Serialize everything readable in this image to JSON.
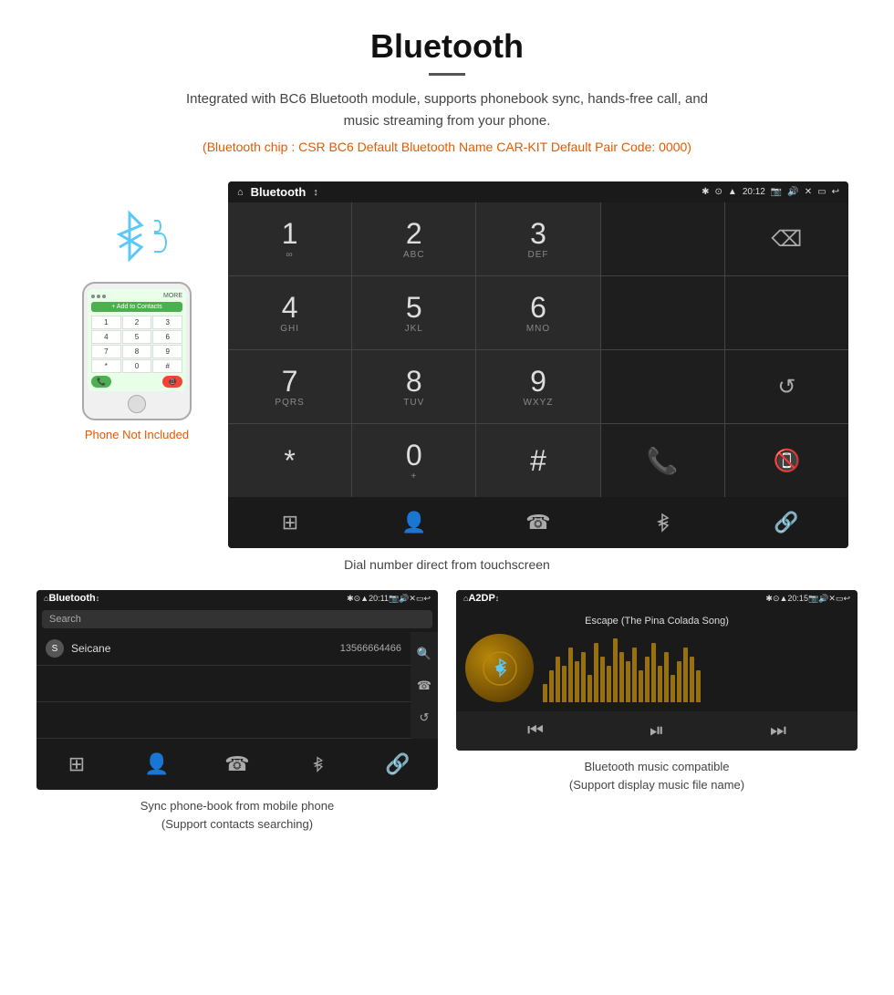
{
  "header": {
    "title": "Bluetooth",
    "description": "Integrated with BC6 Bluetooth module, supports phonebook sync, hands-free call, and music streaming from your phone.",
    "spec_line": "(Bluetooth chip : CSR BC6    Default Bluetooth Name CAR-KIT    Default Pair Code: 0000)"
  },
  "dial_screen": {
    "status_bar": {
      "left": "⌂",
      "title": "Bluetooth",
      "usb": "↕",
      "time": "20:12"
    },
    "keys": [
      {
        "num": "1",
        "sub": "∞"
      },
      {
        "num": "2",
        "sub": "ABC"
      },
      {
        "num": "3",
        "sub": "DEF"
      },
      {
        "num": "",
        "sub": ""
      },
      {
        "num": "⌫",
        "sub": ""
      },
      {
        "num": "4",
        "sub": "GHI"
      },
      {
        "num": "5",
        "sub": "JKL"
      },
      {
        "num": "6",
        "sub": "MNO"
      },
      {
        "num": "",
        "sub": ""
      },
      {
        "num": "",
        "sub": ""
      },
      {
        "num": "7",
        "sub": "PQRS"
      },
      {
        "num": "8",
        "sub": "TUV"
      },
      {
        "num": "9",
        "sub": "WXYZ"
      },
      {
        "num": "",
        "sub": ""
      },
      {
        "num": "↺",
        "sub": ""
      },
      {
        "num": "*",
        "sub": ""
      },
      {
        "num": "0",
        "sub": "+"
      },
      {
        "num": "#",
        "sub": ""
      },
      {
        "num": "📞",
        "sub": ""
      },
      {
        "num": "📵",
        "sub": ""
      }
    ],
    "bottom_nav": [
      "⊞",
      "👤",
      "☎",
      "✱",
      "🔗"
    ]
  },
  "dial_caption": "Dial number direct from touchscreen",
  "phonebook_screen": {
    "status_bar": {
      "title": "Bluetooth",
      "time": "20:11"
    },
    "search_placeholder": "Search",
    "contacts": [
      {
        "letter": "S",
        "name": "Seicane",
        "number": "13566664466"
      }
    ],
    "sidebar_icons": [
      "🔍",
      "☎",
      "↺"
    ]
  },
  "music_screen": {
    "status_bar": {
      "title": "A2DP",
      "time": "20:15"
    },
    "song_title": "Escape (The Pina Colada Song)",
    "album_icon": "🎵",
    "controls": [
      "⏮",
      "⏯",
      "⏭"
    ]
  },
  "captions": {
    "phone_not_included": "Phone Not Included",
    "phonebook_caption": "Sync phone-book from mobile phone\n(Support contacts searching)",
    "music_caption": "Bluetooth music compatible\n(Support display music file name)"
  },
  "eq_heights": [
    20,
    35,
    50,
    40,
    60,
    45,
    55,
    30,
    65,
    50,
    40,
    70,
    55,
    45,
    60,
    35,
    50,
    65,
    40,
    55,
    30,
    45,
    60,
    50,
    35
  ]
}
